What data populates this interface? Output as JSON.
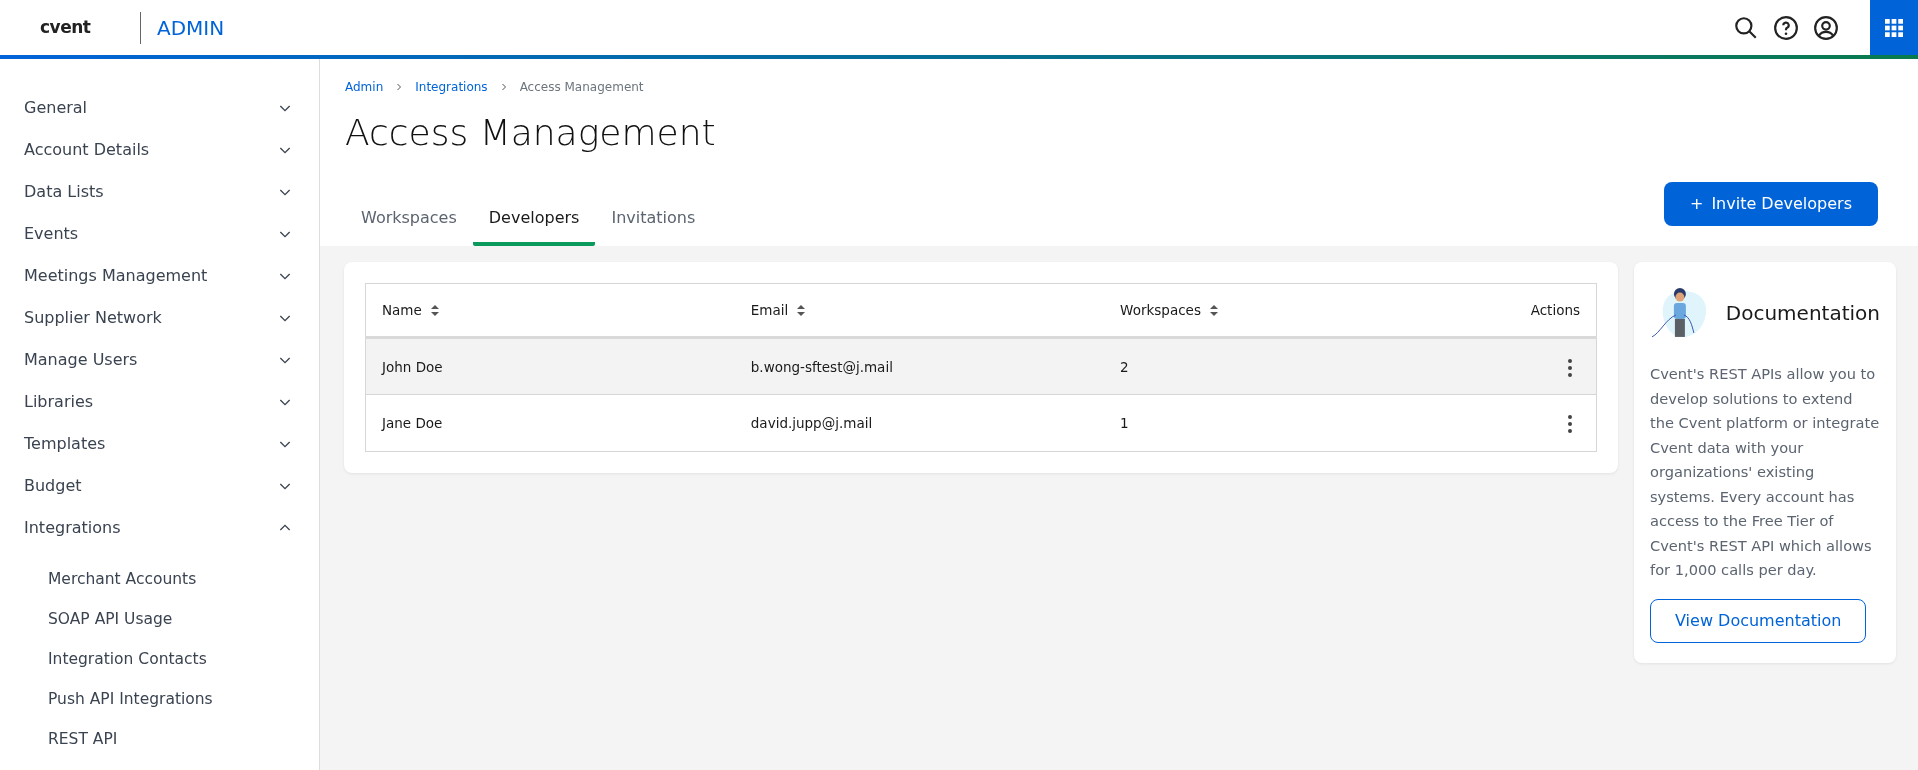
{
  "header": {
    "logo": "cvent",
    "app_title": "ADMIN"
  },
  "sidebar": {
    "items": [
      {
        "label": "General",
        "expanded": false
      },
      {
        "label": "Account Details",
        "expanded": false
      },
      {
        "label": "Data Lists",
        "expanded": false
      },
      {
        "label": "Events",
        "expanded": false
      },
      {
        "label": "Meetings Management",
        "expanded": false
      },
      {
        "label": "Supplier Network",
        "expanded": false
      },
      {
        "label": "Manage Users",
        "expanded": false
      },
      {
        "label": "Libraries",
        "expanded": false
      },
      {
        "label": "Templates",
        "expanded": false
      },
      {
        "label": "Budget",
        "expanded": false
      },
      {
        "label": "Integrations",
        "expanded": true,
        "children": [
          {
            "label": "Merchant Accounts"
          },
          {
            "label": "SOAP API Usage"
          },
          {
            "label": "Integration Contacts"
          },
          {
            "label": "Push API Integrations"
          },
          {
            "label": "REST API"
          }
        ]
      }
    ]
  },
  "breadcrumb": [
    {
      "label": "Admin",
      "kind": "link"
    },
    {
      "label": "Integrations",
      "kind": "link"
    },
    {
      "label": "Access Management",
      "kind": "current"
    }
  ],
  "page_title": "Access Management",
  "tabs": [
    {
      "label": "Workspaces",
      "selected": false
    },
    {
      "label": "Developers",
      "selected": true
    },
    {
      "label": "Invitations",
      "selected": false
    }
  ],
  "invite_button": {
    "icon": "+",
    "label": "Invite Developers"
  },
  "table": {
    "columns": [
      {
        "label": "Name",
        "sortable": true
      },
      {
        "label": "Email",
        "sortable": true
      },
      {
        "label": "Workspaces",
        "sortable": true
      },
      {
        "label": "Actions",
        "sortable": false
      }
    ],
    "rows": [
      {
        "name": "John Doe",
        "email": "b.wong-sftest@j.mail",
        "workspaces": "2",
        "selected": true
      },
      {
        "name": "Jane Doe",
        "email": "david.jupp@j.mail",
        "workspaces": "1",
        "selected": false
      }
    ]
  },
  "documentation": {
    "title": "Documentation",
    "text": "Cvent's REST APIs allow you to develop solutions to extend the Cvent platform or integrate Cvent data with your organizations' existing systems. Every account has access to the Free Tier of Cvent's REST API which allows for 1,000 calls per day.",
    "button": "View Documentation"
  }
}
